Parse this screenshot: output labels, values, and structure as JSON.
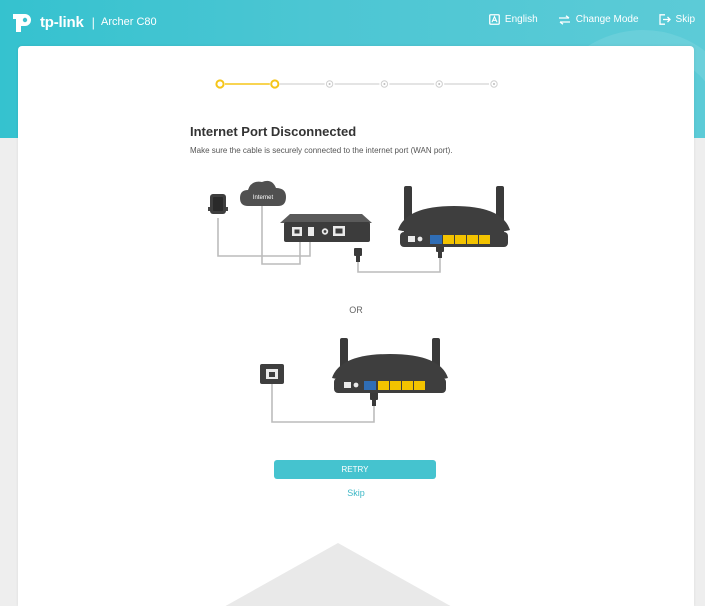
{
  "header": {
    "brand": "tp-link",
    "model": "Archer C80",
    "nav": {
      "language": "English",
      "change_mode": "Change Mode",
      "skip": "Skip"
    }
  },
  "progress": {
    "total_steps": 6,
    "completed_steps": 2
  },
  "main": {
    "title": "Internet Port Disconnected",
    "description": "Make sure the cable is securely connected to the internet port (WAN port).",
    "cloud_label": "Internet",
    "or_label": "OR",
    "retry_button": "RETRY",
    "skip_link": "Skip"
  },
  "colors": {
    "brand_teal": "#45c3cf",
    "active_step": "#f5c518",
    "device_dark": "#3a3a3a",
    "lan_port_yellow": "#f3c300",
    "wan_port_blue": "#2f6db5"
  }
}
